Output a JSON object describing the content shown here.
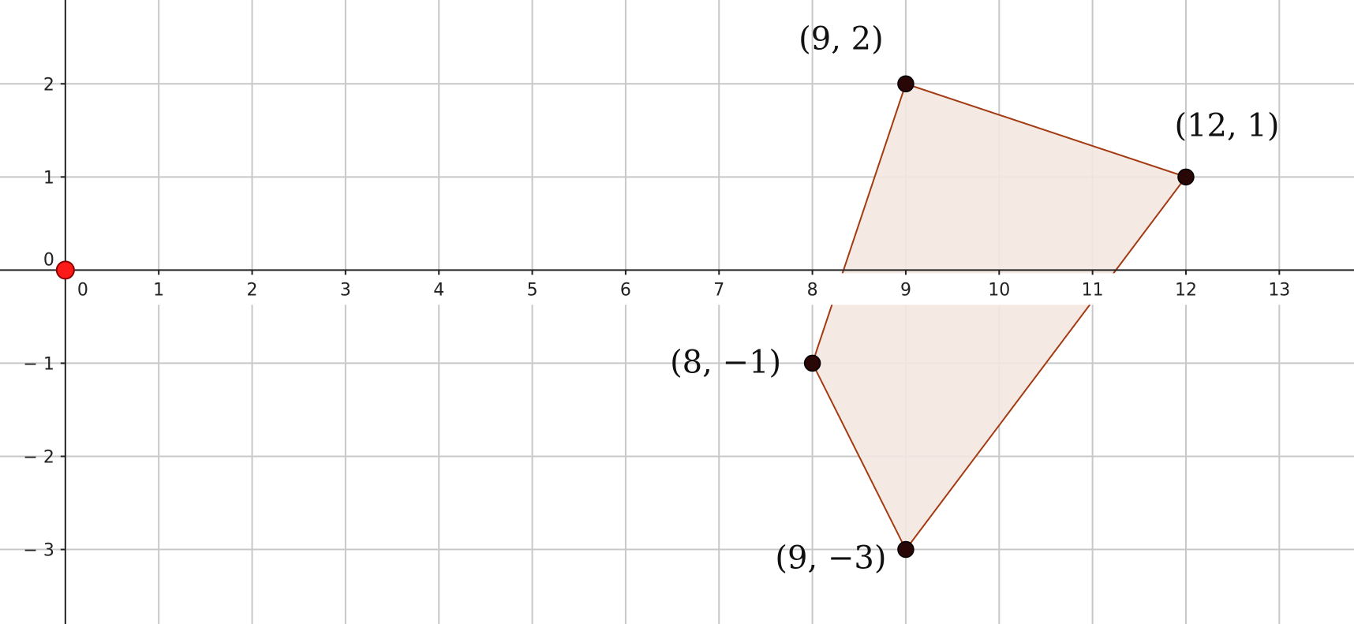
{
  "colors": {
    "grid": "#c8c8c8",
    "axis": "#222222",
    "polygon_stroke": "#a33a12",
    "polygon_fill": "#f4e7e1",
    "vertex_fill": "#2a0707",
    "origin_point": "#ff1a1a"
  },
  "chart_data": {
    "type": "scatter",
    "xlim": [
      -0.7,
      13.8
    ],
    "ylim": [
      -3.8,
      2.9
    ],
    "grid": true,
    "x_ticks": [
      0,
      1,
      2,
      3,
      4,
      5,
      6,
      7,
      8,
      9,
      10,
      11,
      12,
      13
    ],
    "y_ticks": [
      -3,
      -2,
      -1,
      0,
      1,
      2
    ],
    "x_tick_labels": [
      "0",
      "1",
      "2",
      "3",
      "4",
      "5",
      "6",
      "7",
      "8",
      "9",
      "10",
      "11",
      "12",
      "13"
    ],
    "y_tick_labels": [
      "− 3",
      "− 2",
      "− 1",
      "0",
      "1",
      "2"
    ],
    "polygon": [
      {
        "x": 9,
        "y": 2,
        "label": "(9, 2)"
      },
      {
        "x": 12,
        "y": 1,
        "label": "(12, 1)"
      },
      {
        "x": 9,
        "y": -3,
        "label": "(9, −3)"
      },
      {
        "x": 8,
        "y": -1,
        "label": "(8, −1)"
      }
    ],
    "origin": {
      "x": 0,
      "y": 0
    }
  }
}
